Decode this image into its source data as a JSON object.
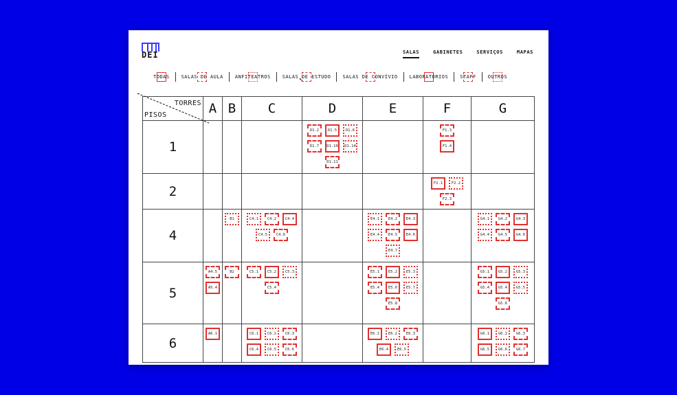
{
  "logo": {
    "text": "DEI"
  },
  "nav": [
    {
      "label": "SALAS",
      "active": true
    },
    {
      "label": "GABINETES",
      "active": false
    },
    {
      "label": "SERVIÇOS",
      "active": false
    },
    {
      "label": "MAPAS",
      "active": false
    }
  ],
  "filters": [
    {
      "label": "TODAS",
      "style": "solid"
    },
    {
      "label": "SALAS DE AULA",
      "style": "dashed"
    },
    {
      "label": "ANFITEATROS",
      "style": "dotted"
    },
    {
      "label": "SALAS DE ESTUDO",
      "style": "dashed"
    },
    {
      "label": "SALAS DE CONVÍVIO",
      "style": "dashed"
    },
    {
      "label": "LABORATÓRIOS",
      "style": "solid"
    },
    {
      "label": "STAFF",
      "style": "dashed"
    },
    {
      "label": "OUTROS",
      "style": "dotted"
    }
  ],
  "grid": {
    "corner_top": "TORRES",
    "corner_bottom": "PISOS",
    "towers": [
      "A",
      "B",
      "C",
      "D",
      "E",
      "F",
      "G"
    ],
    "floors": [
      {
        "floor": "1",
        "rooms": {
          "A": [],
          "B": [],
          "C": [],
          "D": [
            "D1.2",
            "D1.5",
            "D1.6",
            "D1.7",
            "D1.10",
            "D1.14",
            "D1.11"
          ],
          "E": [],
          "F": [
            "F1.3",
            "F1.4"
          ],
          "G": []
        }
      },
      {
        "floor": "2",
        "rooms": {
          "A": [],
          "B": [],
          "C": [],
          "D": [],
          "E": [],
          "F": [
            "F2.1",
            "F2.2",
            "F2.3"
          ],
          "G": []
        }
      },
      {
        "floor": "4",
        "rooms": {
          "A": [],
          "B": [
            "B1"
          ],
          "C": [
            "C4.1",
            "C4.2",
            "C4.4",
            "C4.5",
            "C4.6"
          ],
          "D": [],
          "E": [
            "E4.1",
            "E4.2",
            "E4.3",
            "E4.4",
            "E4.5",
            "E4.6",
            "E4.7"
          ],
          "F": [],
          "G": [
            "G4.1",
            "G4.2",
            "G4.3",
            "G4.4",
            "G4.5",
            "G4.6"
          ]
        }
      },
      {
        "floor": "5",
        "rooms": {
          "A": [
            "A4.5",
            "A5.4"
          ],
          "B": [
            "B2"
          ],
          "C": [
            "C5.1",
            "C5.2",
            "C5.3",
            "C5.4"
          ],
          "D": [],
          "E": [
            "E5.1",
            "E5.2",
            "E5.3",
            "E5.4",
            "E5.6",
            "E5.7",
            "E5.8"
          ],
          "F": [],
          "G": [
            "G5.1",
            "G5.2",
            "G5.3",
            "G5.4",
            "G5.4",
            "G5.5",
            "G5.6"
          ]
        }
      },
      {
        "floor": "6",
        "rooms": {
          "A": [
            "A6.1"
          ],
          "B": [],
          "C": [
            "C6.1",
            "C6.2",
            "C6.3",
            "C6.4",
            "C6.5",
            "C6.6"
          ],
          "D": [],
          "E": [
            "E6.1",
            "E6.2",
            "E6.3",
            "E6.4",
            "E6.5"
          ],
          "F": [],
          "G": [
            "G6.1",
            "G6.2",
            "G6.3",
            "G6.5",
            "G6.6",
            "G6.7"
          ]
        }
      }
    ]
  }
}
